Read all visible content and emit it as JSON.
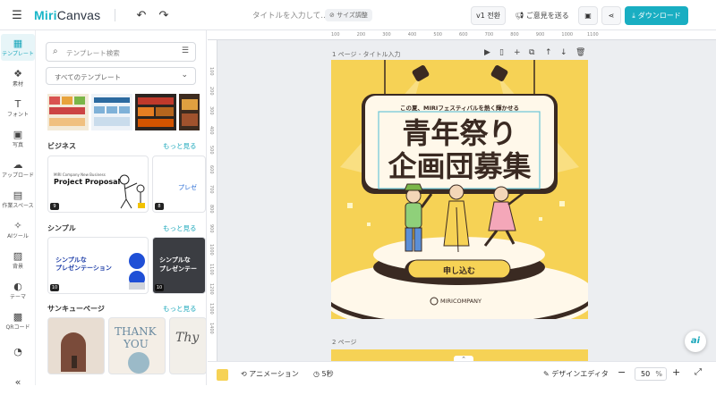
{
  "header": {
    "logo_a": "Miri",
    "logo_b": "Canvas",
    "title_placeholder": "タイトルを入力して…",
    "size_adjust": "⊘ サイズ調整",
    "version": "v1 전환",
    "feedback": "ご意見を送る",
    "download": "ダウンロード"
  },
  "rail": [
    {
      "label": "テンプレート",
      "icon": "template-icon",
      "glyph": "▦"
    },
    {
      "label": "素材",
      "icon": "elements-icon",
      "glyph": "❖"
    },
    {
      "label": "フォント",
      "icon": "text-icon",
      "glyph": "T"
    },
    {
      "label": "写真",
      "icon": "photo-icon",
      "glyph": "▣"
    },
    {
      "label": "アップロード",
      "icon": "upload-icon",
      "glyph": "☁"
    },
    {
      "label": "作業スペース",
      "icon": "workspace-icon",
      "glyph": "▤"
    },
    {
      "label": "AIツール",
      "icon": "ai-tools-icon",
      "glyph": "✧"
    },
    {
      "label": "背景",
      "icon": "background-icon",
      "glyph": "▨"
    },
    {
      "label": "テーマ",
      "icon": "theme-icon",
      "glyph": "◐"
    },
    {
      "label": "QRコード",
      "icon": "qr-icon",
      "glyph": "▩"
    },
    {
      "label": "",
      "icon": "history-icon",
      "glyph": "◔"
    },
    {
      "label": "",
      "icon": "collapse-icon",
      "glyph": "«"
    }
  ],
  "panel": {
    "search_placeholder": "テンプレート検索",
    "filter": "すべてのテンプレート",
    "more": "もっと見る",
    "sections": [
      {
        "title": "ビジネス"
      },
      {
        "title": "シンプル"
      },
      {
        "title": "サンキューページ"
      }
    ],
    "cards": {
      "proposal_small": "MIRI Company New Business",
      "proposal_title": "Project Proposal",
      "proposal_badge": "9",
      "side_badge": "8",
      "side_text": "プレゼ",
      "simple1_a": "シンプルな",
      "simple1_b": "プレゼンテーション",
      "simple1_badge": "10",
      "simple2_a": "シンプルな",
      "simple2_b": "プレゼンテー",
      "simple2_badge": "10",
      "thank": "THANK",
      "you": "YOU",
      "thy": "Thy"
    }
  },
  "ruler": {
    "h": [
      "100",
      "200",
      "300",
      "400",
      "500",
      "600",
      "700",
      "800",
      "900",
      "1000",
      "1100"
    ],
    "v": [
      "100",
      "200",
      "300",
      "400",
      "500",
      "600",
      "700",
      "800",
      "900",
      "1000",
      "1100",
      "1200",
      "1300",
      "1400"
    ]
  },
  "page1_label": "1 ページ - タイトル入力",
  "page2_label": "2 ページ",
  "poster": {
    "subtitle": "この夏、MIRIフェスティバルを熱く輝かせる",
    "title1": "青年祭り",
    "title2": "企画団募集",
    "cta": "申し込む",
    "brand": "MIRICOMPANY"
  },
  "bottom": {
    "animation": "アニメーション",
    "duration": "5秒",
    "design_editor": "デザインエディタ",
    "zoom": "50",
    "zoom_unit": "%"
  },
  "colors": {
    "accent": "#19aec2",
    "poster_bg": "#f6d255",
    "dark": "#3a2a22"
  }
}
